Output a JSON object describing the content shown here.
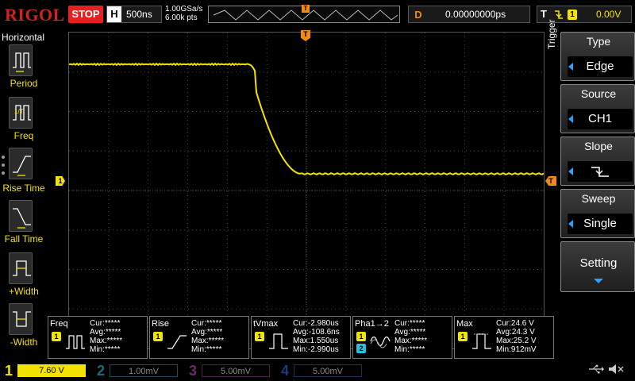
{
  "top": {
    "logo": "RIGOL",
    "run_state": "STOP",
    "horizontal_label": "H",
    "timebase": "500ns",
    "sample_rate": "1.00GSa/s",
    "memory_depth": "6.00k pts",
    "trigger_position_marker": "T",
    "delay_label": "D",
    "delay_value": "0.00000000ps",
    "trigger_label": "T",
    "trigger_slope_icon": "falling-edge-icon",
    "trigger_source_badge": "1",
    "trigger_level": "0.00V"
  },
  "left_menu": {
    "title": "Horizontal",
    "items": [
      {
        "label": "Period",
        "icon": "period-icon"
      },
      {
        "label": "Freq",
        "icon": "freq-icon"
      },
      {
        "label": "Rise Time",
        "icon": "rise-time-icon"
      },
      {
        "label": "Fall Time",
        "icon": "fall-time-icon"
      },
      {
        "label": "+Width",
        "icon": "positive-width-icon"
      },
      {
        "label": "-Width",
        "icon": "negative-width-icon"
      }
    ]
  },
  "markers": {
    "channel1": "1",
    "trigger_top": "T",
    "trigger_level": "T"
  },
  "right_menu": {
    "title": "Trigger",
    "items": [
      {
        "head": "Type",
        "value": "Edge"
      },
      {
        "head": "Source",
        "value": "CH1"
      },
      {
        "head": "Slope",
        "value": "",
        "icon": "falling-edge-icon"
      },
      {
        "head": "Sweep",
        "value": "Single"
      },
      {
        "head": "Setting",
        "value": "",
        "icon": "chevron-down-icon"
      }
    ]
  },
  "measurements": [
    {
      "name": "Freq",
      "badge": "1",
      "rows": [
        "Cur:*****",
        "Avg:*****",
        "Max:*****",
        "Min:*****"
      ]
    },
    {
      "name": "Rise",
      "badge": "1",
      "rows": [
        "Cur:*****",
        "Avg:*****",
        "Max:*****",
        "Min:*****"
      ]
    },
    {
      "name": "tVmax",
      "badge": "1",
      "rows": [
        "Cur:-2.980us",
        "Avg:-108.6ns",
        "Max:1.550us",
        "Min:-2.990us"
      ]
    },
    {
      "name": "Pha1→2",
      "badge": "1",
      "badge2": "2",
      "rows": [
        "Cur:*****",
        "Avg:*****",
        "Max:*****",
        "Min:*****"
      ]
    },
    {
      "name": "Max",
      "badge": "1",
      "rows": [
        "Cur:24.6 V",
        "Avg:24.3 V",
        "Max:25.2 V",
        "Min:912mV"
      ]
    }
  ],
  "channels": [
    {
      "num": "1",
      "scale": "7.60 V",
      "color": "#f2e300",
      "active": true
    },
    {
      "num": "2",
      "scale": "1.00mV",
      "color": "#26c0e0",
      "active": false
    },
    {
      "num": "3",
      "scale": "5.00mV",
      "color": "#d040d0",
      "active": false
    },
    {
      "num": "4",
      "scale": "5.00mV",
      "color": "#2070e0",
      "active": false
    }
  ],
  "status_icons": [
    "usb-icon",
    "speaker-mute-icon"
  ],
  "colors": {
    "ch1_trace": "#f2e300",
    "trigger": "#f08a14",
    "logo": "#d42020",
    "stop": "#e62020",
    "accent_arrow": "#2aa0ff"
  }
}
